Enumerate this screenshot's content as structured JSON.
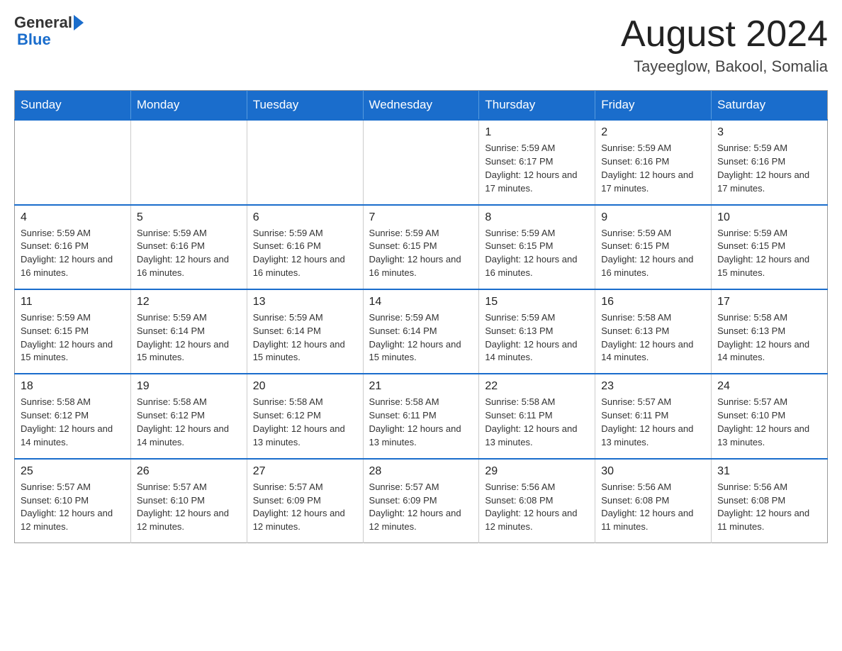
{
  "header": {
    "logo_text_general": "General",
    "logo_text_blue": "Blue",
    "month_title": "August 2024",
    "location": "Tayeeglow, Bakool, Somalia"
  },
  "days_of_week": [
    "Sunday",
    "Monday",
    "Tuesday",
    "Wednesday",
    "Thursday",
    "Friday",
    "Saturday"
  ],
  "weeks": [
    {
      "days": [
        {
          "num": "",
          "info": ""
        },
        {
          "num": "",
          "info": ""
        },
        {
          "num": "",
          "info": ""
        },
        {
          "num": "",
          "info": ""
        },
        {
          "num": "1",
          "info": "Sunrise: 5:59 AM\nSunset: 6:17 PM\nDaylight: 12 hours and 17 minutes."
        },
        {
          "num": "2",
          "info": "Sunrise: 5:59 AM\nSunset: 6:16 PM\nDaylight: 12 hours and 17 minutes."
        },
        {
          "num": "3",
          "info": "Sunrise: 5:59 AM\nSunset: 6:16 PM\nDaylight: 12 hours and 17 minutes."
        }
      ]
    },
    {
      "days": [
        {
          "num": "4",
          "info": "Sunrise: 5:59 AM\nSunset: 6:16 PM\nDaylight: 12 hours and 16 minutes."
        },
        {
          "num": "5",
          "info": "Sunrise: 5:59 AM\nSunset: 6:16 PM\nDaylight: 12 hours and 16 minutes."
        },
        {
          "num": "6",
          "info": "Sunrise: 5:59 AM\nSunset: 6:16 PM\nDaylight: 12 hours and 16 minutes."
        },
        {
          "num": "7",
          "info": "Sunrise: 5:59 AM\nSunset: 6:15 PM\nDaylight: 12 hours and 16 minutes."
        },
        {
          "num": "8",
          "info": "Sunrise: 5:59 AM\nSunset: 6:15 PM\nDaylight: 12 hours and 16 minutes."
        },
        {
          "num": "9",
          "info": "Sunrise: 5:59 AM\nSunset: 6:15 PM\nDaylight: 12 hours and 16 minutes."
        },
        {
          "num": "10",
          "info": "Sunrise: 5:59 AM\nSunset: 6:15 PM\nDaylight: 12 hours and 15 minutes."
        }
      ]
    },
    {
      "days": [
        {
          "num": "11",
          "info": "Sunrise: 5:59 AM\nSunset: 6:15 PM\nDaylight: 12 hours and 15 minutes."
        },
        {
          "num": "12",
          "info": "Sunrise: 5:59 AM\nSunset: 6:14 PM\nDaylight: 12 hours and 15 minutes."
        },
        {
          "num": "13",
          "info": "Sunrise: 5:59 AM\nSunset: 6:14 PM\nDaylight: 12 hours and 15 minutes."
        },
        {
          "num": "14",
          "info": "Sunrise: 5:59 AM\nSunset: 6:14 PM\nDaylight: 12 hours and 15 minutes."
        },
        {
          "num": "15",
          "info": "Sunrise: 5:59 AM\nSunset: 6:13 PM\nDaylight: 12 hours and 14 minutes."
        },
        {
          "num": "16",
          "info": "Sunrise: 5:58 AM\nSunset: 6:13 PM\nDaylight: 12 hours and 14 minutes."
        },
        {
          "num": "17",
          "info": "Sunrise: 5:58 AM\nSunset: 6:13 PM\nDaylight: 12 hours and 14 minutes."
        }
      ]
    },
    {
      "days": [
        {
          "num": "18",
          "info": "Sunrise: 5:58 AM\nSunset: 6:12 PM\nDaylight: 12 hours and 14 minutes."
        },
        {
          "num": "19",
          "info": "Sunrise: 5:58 AM\nSunset: 6:12 PM\nDaylight: 12 hours and 14 minutes."
        },
        {
          "num": "20",
          "info": "Sunrise: 5:58 AM\nSunset: 6:12 PM\nDaylight: 12 hours and 13 minutes."
        },
        {
          "num": "21",
          "info": "Sunrise: 5:58 AM\nSunset: 6:11 PM\nDaylight: 12 hours and 13 minutes."
        },
        {
          "num": "22",
          "info": "Sunrise: 5:58 AM\nSunset: 6:11 PM\nDaylight: 12 hours and 13 minutes."
        },
        {
          "num": "23",
          "info": "Sunrise: 5:57 AM\nSunset: 6:11 PM\nDaylight: 12 hours and 13 minutes."
        },
        {
          "num": "24",
          "info": "Sunrise: 5:57 AM\nSunset: 6:10 PM\nDaylight: 12 hours and 13 minutes."
        }
      ]
    },
    {
      "days": [
        {
          "num": "25",
          "info": "Sunrise: 5:57 AM\nSunset: 6:10 PM\nDaylight: 12 hours and 12 minutes."
        },
        {
          "num": "26",
          "info": "Sunrise: 5:57 AM\nSunset: 6:10 PM\nDaylight: 12 hours and 12 minutes."
        },
        {
          "num": "27",
          "info": "Sunrise: 5:57 AM\nSunset: 6:09 PM\nDaylight: 12 hours and 12 minutes."
        },
        {
          "num": "28",
          "info": "Sunrise: 5:57 AM\nSunset: 6:09 PM\nDaylight: 12 hours and 12 minutes."
        },
        {
          "num": "29",
          "info": "Sunrise: 5:56 AM\nSunset: 6:08 PM\nDaylight: 12 hours and 12 minutes."
        },
        {
          "num": "30",
          "info": "Sunrise: 5:56 AM\nSunset: 6:08 PM\nDaylight: 12 hours and 11 minutes."
        },
        {
          "num": "31",
          "info": "Sunrise: 5:56 AM\nSunset: 6:08 PM\nDaylight: 12 hours and 11 minutes."
        }
      ]
    }
  ]
}
